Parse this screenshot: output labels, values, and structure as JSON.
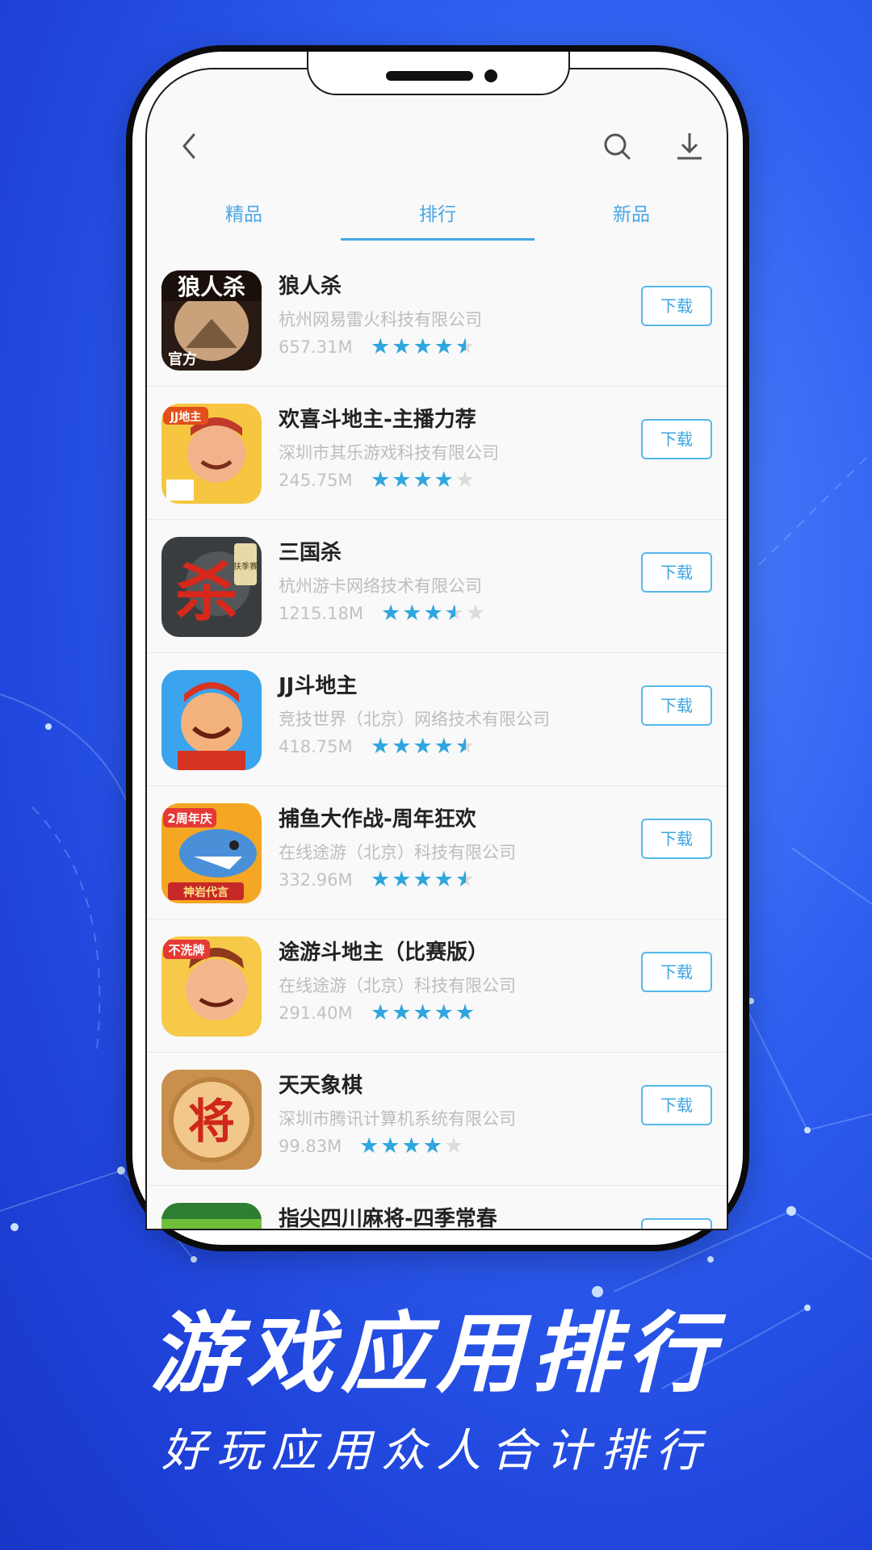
{
  "header": {
    "back_icon": "chevron-left-icon",
    "search_icon": "search-icon",
    "download_icon": "download-icon"
  },
  "tabs": [
    {
      "label": "精品",
      "active": false
    },
    {
      "label": "排行",
      "active": true
    },
    {
      "label": "新品",
      "active": false
    }
  ],
  "apps": [
    {
      "name": "狼人杀",
      "developer": "杭州网易雷火科技有限公司",
      "size": "657.31M",
      "rating": 4.5,
      "download_label": "下载"
    },
    {
      "name": "欢喜斗地主-主播力荐",
      "developer": "深圳市其乐游戏科技有限公司",
      "size": "245.75M",
      "rating": 4,
      "download_label": "下载"
    },
    {
      "name": "三国杀",
      "developer": "杭州游卡网络技术有限公司",
      "size": "1215.18M",
      "rating": 3.5,
      "download_label": "下载"
    },
    {
      "name": "JJ斗地主",
      "developer": "竞技世界（北京）网络技术有限公司",
      "size": "418.75M",
      "rating": 4.5,
      "download_label": "下载"
    },
    {
      "name": "捕鱼大作战-周年狂欢",
      "developer": "在线途游（北京）科技有限公司",
      "size": "332.96M",
      "rating": 4.5,
      "download_label": "下载"
    },
    {
      "name": "途游斗地主（比赛版）",
      "developer": "在线途游（北京）科技有限公司",
      "size": "291.40M",
      "rating": 5,
      "download_label": "下载"
    },
    {
      "name": "天天象棋",
      "developer": "深圳市腾讯计算机系统有限公司",
      "size": "99.83M",
      "rating": 4,
      "download_label": "下载"
    },
    {
      "name": "指尖四川麻将-四季常春",
      "developer": "",
      "size": "",
      "rating": 0,
      "download_label": ""
    }
  ],
  "icon_text": {
    "app1": "狼人杀",
    "app1_badge": "官方",
    "app2_badge": "JJ地主",
    "app3": "杀",
    "app3_badge": "扶季赛",
    "app5_badge": "2周年庆",
    "app5_sub": "神岩代言",
    "app6_badge": "不洗牌",
    "app7": "将"
  },
  "promo": {
    "headline": "游戏应用排行",
    "subline": "好玩应用众人合计排行"
  },
  "colors": {
    "accent": "#46a6e6",
    "star": "#2fa6de",
    "background": "#2e5ff0"
  }
}
